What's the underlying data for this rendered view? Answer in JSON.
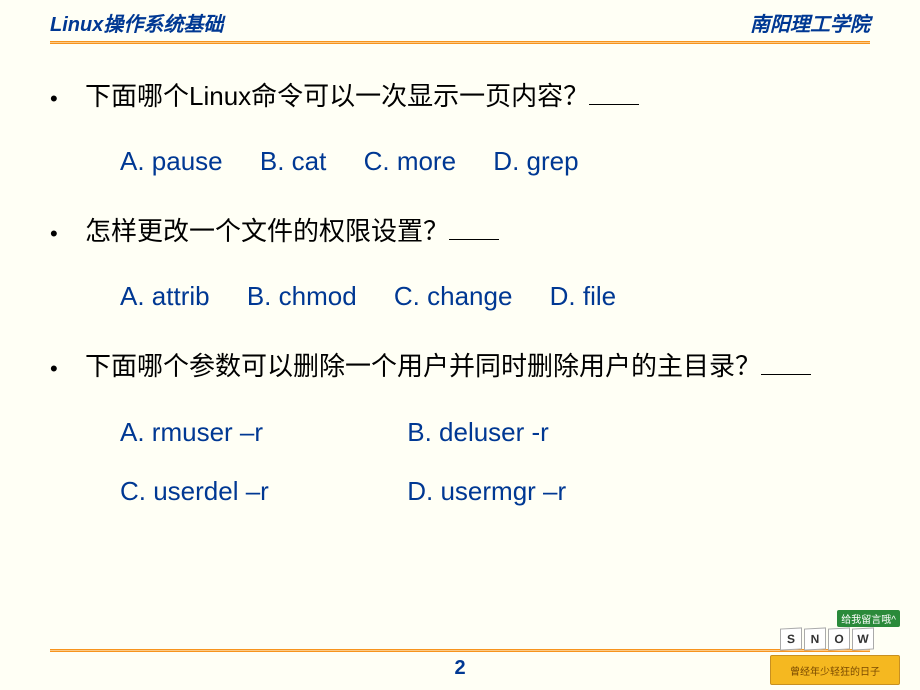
{
  "header": {
    "left": "Linux操作系统基础",
    "right": "南阳理工学院"
  },
  "questions": [
    {
      "text": "下面哪个Linux命令可以一次显示一页内容？",
      "options_inline": [
        "A. pause",
        "B. cat",
        "C. more",
        "D. grep"
      ]
    },
    {
      "text": "怎样更改一个文件的权限设置？",
      "options_inline": [
        "A. attrib",
        "B. chmod",
        "C. change",
        "D. file"
      ]
    },
    {
      "text": "下面哪个参数可以删除一个用户并同时删除用户的主目录？",
      "options_rows": [
        [
          "A. rmuser –r",
          "B. deluser -r"
        ],
        [
          "C. userdel –r",
          "D. usermgr –r"
        ]
      ]
    }
  ],
  "page_number": "2",
  "decoration": {
    "top_label": "给我留言哦^",
    "cubes": [
      "S",
      "N",
      "O",
      "W"
    ],
    "book_text": "曾经年少轻狂的日子"
  }
}
